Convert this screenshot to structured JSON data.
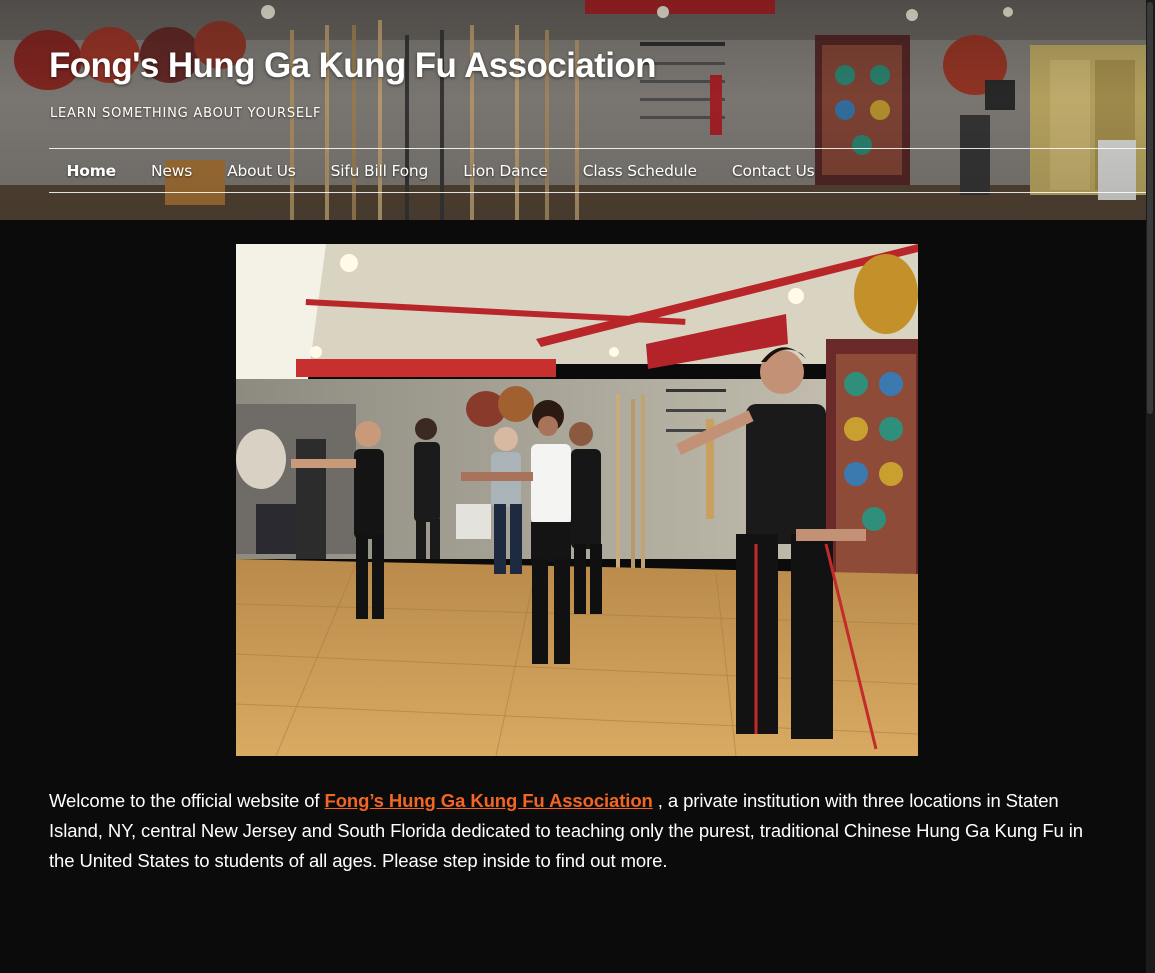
{
  "site": {
    "title": "Fong's Hung Ga Kung Fu Association",
    "tagline": "LEARN SOMETHING ABOUT YOURSELF"
  },
  "nav": {
    "items": [
      {
        "label": "Home",
        "active": true
      },
      {
        "label": "News",
        "active": false
      },
      {
        "label": "About Us",
        "active": false
      },
      {
        "label": "Sifu Bill Fong",
        "active": false
      },
      {
        "label": "Lion Dance",
        "active": false
      },
      {
        "label": "Class Schedule",
        "active": false
      },
      {
        "label": "Contact Us",
        "active": false
      }
    ]
  },
  "main": {
    "intro_before": "Welcome to the official website of ",
    "intro_org": "Fong’s Hung Ga Kung Fu Association",
    "intro_after": " , a private institution with three locations in Staten Island, NY, central New Jersey and South Florida dedicated to teaching only the purest, traditional Chinese Hung Ga Kung Fu in the United States to students of all ages. Please step inside to find out more."
  },
  "colors": {
    "background": "#0b0b0b",
    "text": "#ffffff",
    "accent": "#f26522"
  }
}
